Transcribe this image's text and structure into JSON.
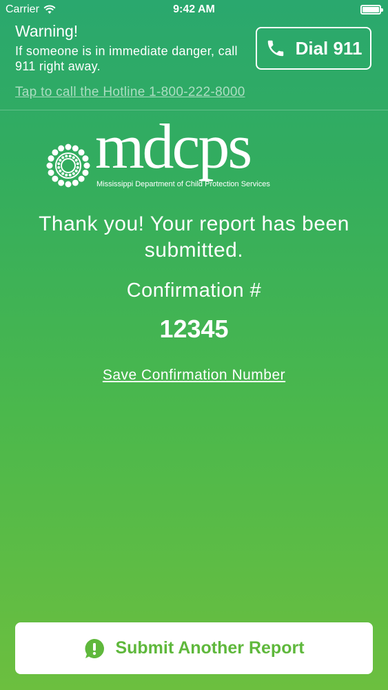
{
  "status_bar": {
    "carrier": "Carrier",
    "time": "9:42 AM",
    "battery_level": 1.0
  },
  "warning": {
    "title": "Warning!",
    "text": "If someone is in immediate danger, call 911 right away.",
    "dial_button_label": "Dial 911",
    "hotline_link": "Tap to call the Hotline 1-800-222-8000"
  },
  "logo": {
    "wordmark": "mdcps",
    "subtitle": "Mississippi Department of Child Protection Services"
  },
  "confirmation": {
    "thanks_text": "Thank you! Your report has been submitted.",
    "label": "Confirmation #",
    "number": "12345",
    "save_link": "Save Confirmation Number"
  },
  "footer": {
    "submit_another_label": "Submit Another Report"
  },
  "colors": {
    "accent_green": "#5fb83c",
    "gradient_top": "#2aa86e",
    "gradient_bottom": "#6cbf3f"
  }
}
